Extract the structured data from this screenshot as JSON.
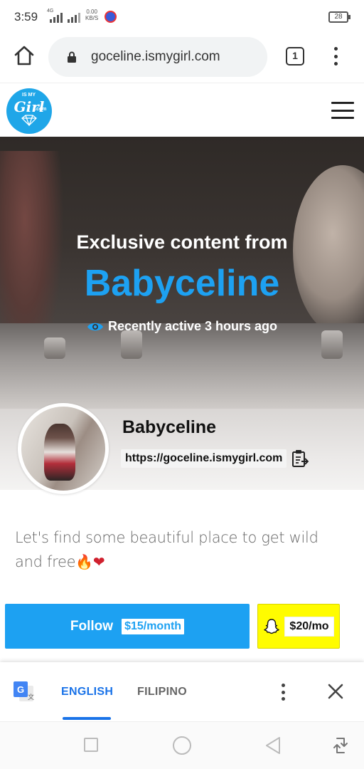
{
  "status_bar": {
    "time": "3:59",
    "network_type": "4G",
    "speed_value": "0.00",
    "speed_unit": "KB/S",
    "battery": "28"
  },
  "browser": {
    "url": "goceline.ismygirl.com",
    "tab_count": "1",
    "icons": {
      "home": "home-icon",
      "lock": "lock-icon",
      "menu": "more-vert-icon"
    }
  },
  "site_header": {
    "logo_text": "Girl",
    "logo_small": "IS MY",
    "logo_sub": ".com",
    "menu_icon": "hamburger-icon"
  },
  "hero": {
    "title": "Exclusive content from",
    "name": "Babyceline",
    "activity": "Recently active 3 hours ago"
  },
  "profile": {
    "name": "Babyceline",
    "url": "https://goceline.ismygirl.com",
    "bio_text": "Let's find some beautiful place to get wild and free",
    "bio_emoji_fire": "🔥",
    "bio_emoji_heart": "❤"
  },
  "actions": {
    "follow_label": "Follow",
    "follow_price": "$15/month",
    "snap_price": "$20/mo",
    "colors": {
      "follow_bg": "#1da1f2",
      "snap_bg": "#fffc00"
    }
  },
  "translate_bar": {
    "languages": [
      "ENGLISH",
      "FILIPINO"
    ],
    "active_language": "ENGLISH",
    "accent": "#1a73e8"
  }
}
